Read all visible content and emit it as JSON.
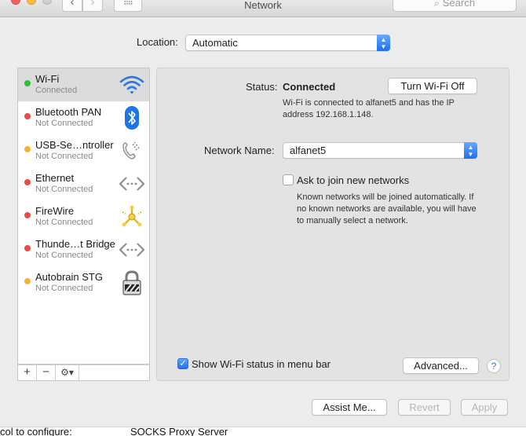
{
  "window": {
    "title": "Network",
    "search_placeholder": "Search",
    "nav_back": "‹",
    "nav_forward": "›",
    "grid_glyph": "⁝⁝⁝⁝"
  },
  "location": {
    "label": "Location:",
    "value": "Automatic"
  },
  "services": [
    {
      "name": "Wi-Fi",
      "status": "Connected",
      "dot_color": "#2ec03d",
      "icon": "wifi-icon",
      "selected": true
    },
    {
      "name": "Bluetooth PAN",
      "status": "Not Connected",
      "dot_color": "#ea4b45",
      "icon": "bluetooth-icon"
    },
    {
      "name": "USB-Se…ntroller",
      "status": "Not Connected",
      "dot_color": "#f4b23a",
      "icon": "phone-icon"
    },
    {
      "name": "Ethernet",
      "status": "Not Connected",
      "dot_color": "#ea4b45",
      "icon": "ethernet-arrows-icon"
    },
    {
      "name": "FireWire",
      "status": "Not Connected",
      "dot_color": "#ea4b45",
      "icon": "firewire-icon"
    },
    {
      "name": "Thunde…t Bridge",
      "status": "Not Connected",
      "dot_color": "#ea4b45",
      "icon": "thunderbolt-arrows-icon"
    },
    {
      "name": "Autobrain STG",
      "status": "Not Connected",
      "dot_color": "#f4b23a",
      "icon": "vpn-lock-icon"
    }
  ],
  "sidebar_controls": {
    "add": "+",
    "remove": "−",
    "action": "⚙▾"
  },
  "detail": {
    "status_label": "Status:",
    "status_value": "Connected",
    "turn_off_button": "Turn Wi-Fi Off",
    "status_description": "Wi-Fi is connected to alfanet5 and has the IP address 192.168.1.148.",
    "network_name_label": "Network Name:",
    "network_name_value": "alfanet5",
    "ask_join_label": "Ask to join new networks",
    "ask_join_checked": false,
    "ask_join_description": "Known networks will be joined automatically. If no known networks are available, you will have to manually select a network.",
    "show_status_label": "Show Wi-Fi status in menu bar",
    "show_status_checked": true,
    "advanced_button": "Advanced...",
    "help_button": "?"
  },
  "footer": {
    "assist_button": "Assist Me...",
    "revert_button": "Revert",
    "apply_button": "Apply"
  },
  "underlay": {
    "left_text": "col to configure:",
    "right_text": "SOCKS Proxy Server"
  },
  "colors": {
    "accent": "#1d6ff0",
    "wifi_blue": "#2a7ae2",
    "bluetooth_blue": "#1f74e8"
  }
}
